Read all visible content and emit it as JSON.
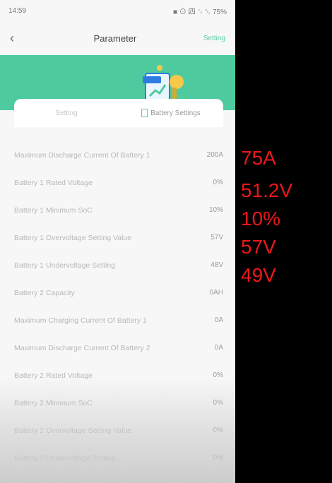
{
  "status_bar": {
    "time": "14:59",
    "right": "■ ⊙ 四 ␜ ␡ 75%"
  },
  "nav": {
    "title": "Parameter",
    "action": "Setting"
  },
  "tabs": [
    {
      "label": "Setting"
    },
    {
      "label": "Battery Settings"
    }
  ],
  "rows": [
    {
      "label": "Maximum Discharge Current Of Battery 1",
      "value": "200A"
    },
    {
      "label": "Battery 1 Rated Voltage",
      "value": "0%"
    },
    {
      "label": "Battery 1 Minimum SoC",
      "value": "10%"
    },
    {
      "label": "Battery 1 Overvoltage Setting Value",
      "value": "57V"
    },
    {
      "label": "Battery 1 Undervoltage Setting",
      "value": "48V"
    },
    {
      "label": "Battery 2 Capacity",
      "value": "0AH"
    },
    {
      "label": "Maximum Charging Current Of Battery 1",
      "value": "0A"
    },
    {
      "label": "Maximum Discharge Current Of Battery 2",
      "value": "0A"
    },
    {
      "label": "Battery 2 Rated Voltage",
      "value": "0%"
    },
    {
      "label": "Battery 2 Minimum SoC",
      "value": "0%"
    },
    {
      "label": "Battery 2 Overvoltage Setting Value",
      "value": "0%"
    },
    {
      "label": "Battery 2 Undervoltage Setting",
      "value": "0%"
    }
  ],
  "overlay_values": [
    "75A",
    "51.2V",
    "10%",
    "57V",
    "49V"
  ],
  "colors": {
    "accent": "#4ecb9e",
    "overlay_red": "#e8181b",
    "panel": "#000000"
  }
}
